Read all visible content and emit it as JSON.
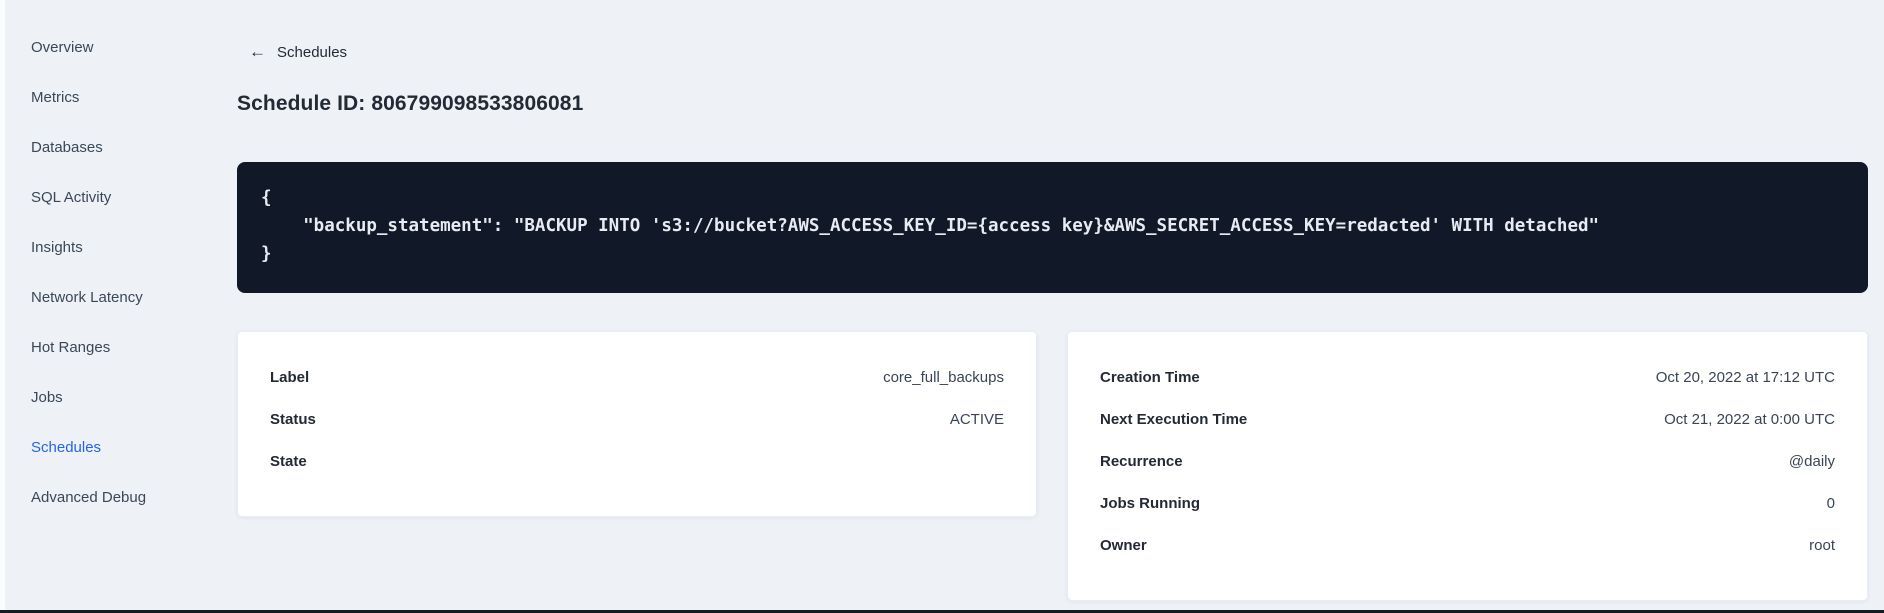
{
  "sidebar": {
    "items": [
      {
        "label": "Overview",
        "active": false
      },
      {
        "label": "Metrics",
        "active": false
      },
      {
        "label": "Databases",
        "active": false
      },
      {
        "label": "SQL Activity",
        "active": false
      },
      {
        "label": "Insights",
        "active": false
      },
      {
        "label": "Network Latency",
        "active": false
      },
      {
        "label": "Hot Ranges",
        "active": false
      },
      {
        "label": "Jobs",
        "active": false
      },
      {
        "label": "Schedules",
        "active": true
      },
      {
        "label": "Advanced Debug",
        "active": false
      }
    ]
  },
  "header": {
    "back_icon": "←",
    "back_label": "Schedules",
    "title": "Schedule ID: 806799098533806081"
  },
  "code_block": {
    "lines": [
      "{",
      "    \"backup_statement\": \"BACKUP INTO 's3://bucket?AWS_ACCESS_KEY_ID={access key}&AWS_SECRET_ACCESS_KEY=redacted' WITH detached\"",
      "}"
    ]
  },
  "details_card": {
    "rows": [
      {
        "label": "Label",
        "value": "core_full_backups"
      },
      {
        "label": "Status",
        "value": "ACTIVE"
      },
      {
        "label": "State",
        "value": ""
      }
    ]
  },
  "schedule_card": {
    "rows": [
      {
        "label": "Creation Time",
        "value": "Oct 20, 2022 at 17:12 UTC"
      },
      {
        "label": "Next Execution Time",
        "value": "Oct 21, 2022 at 0:00 UTC"
      },
      {
        "label": "Recurrence",
        "value": "@daily"
      },
      {
        "label": "Jobs Running",
        "value": "0"
      },
      {
        "label": "Owner",
        "value": "root"
      }
    ]
  },
  "colors": {
    "page_background": "#eef2f7",
    "card_background": "#ffffff",
    "code_background": "#111827",
    "code_text": "#e7ebf2",
    "accent_blue": "#2563eb",
    "text_dark": "#242a35"
  }
}
